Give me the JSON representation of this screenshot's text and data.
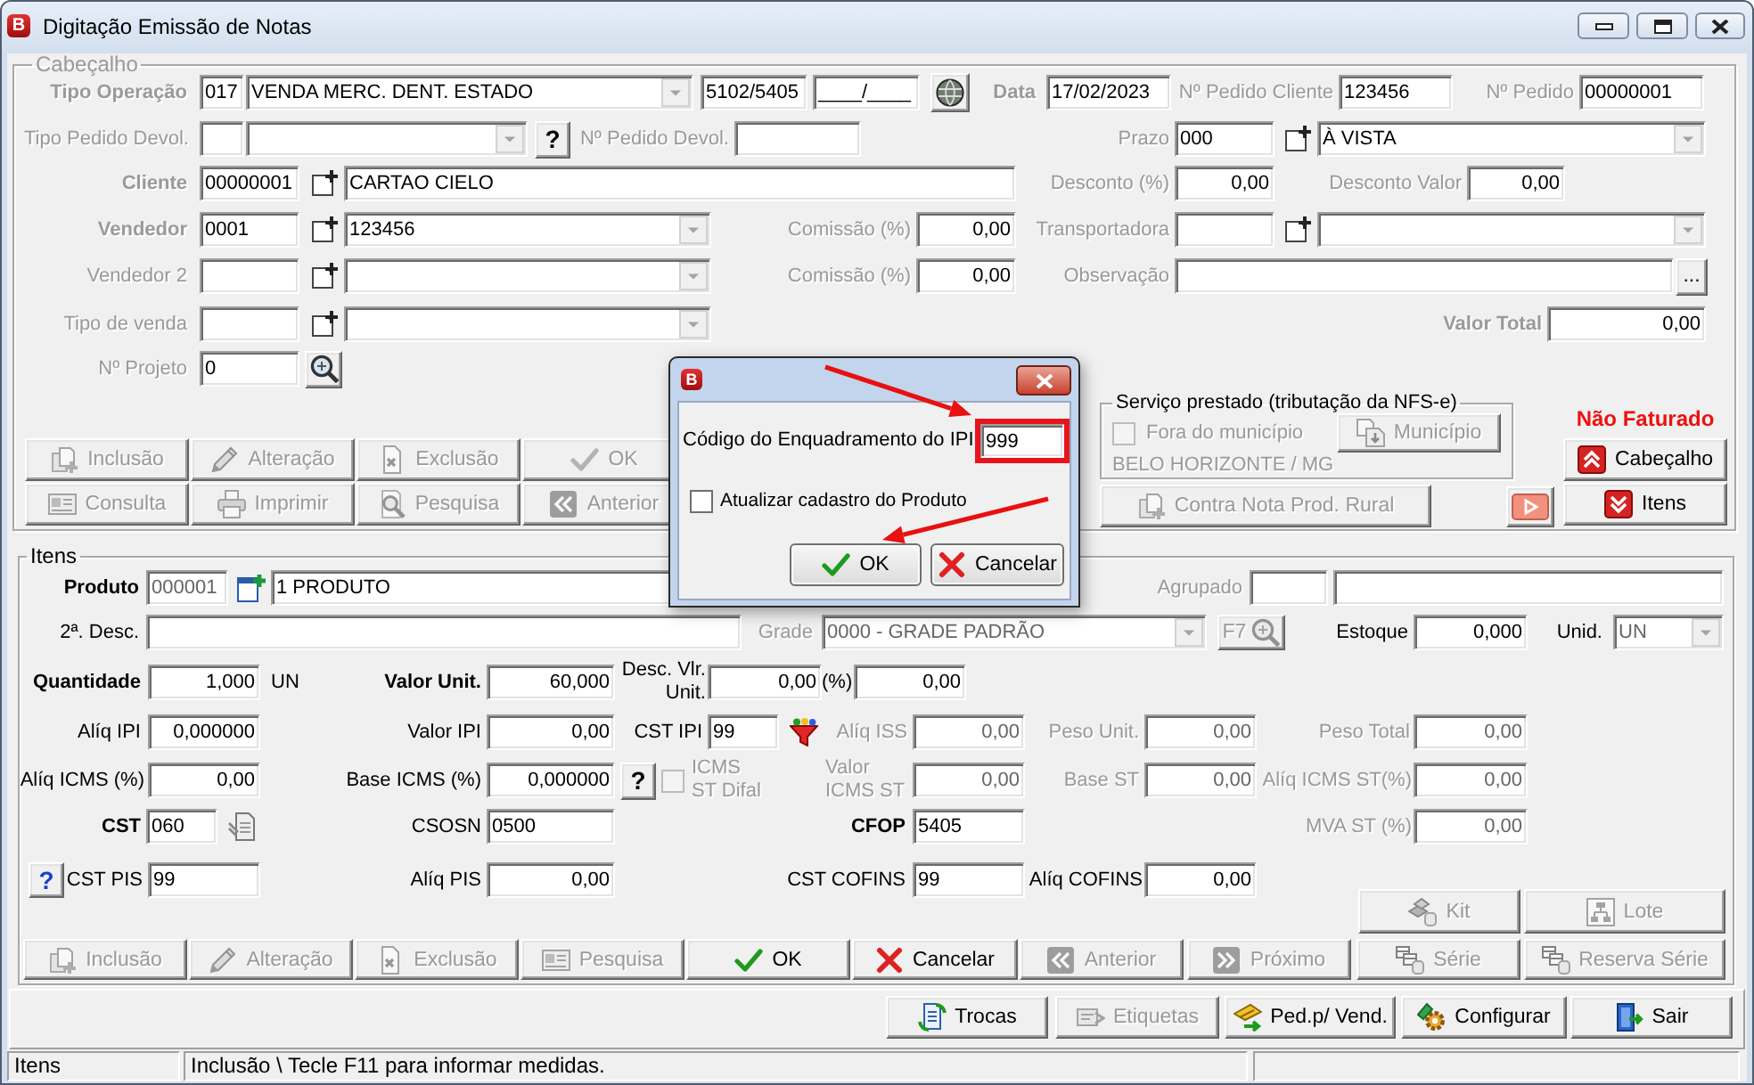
{
  "window": {
    "logo": "B",
    "title": "Digitação Emissão de Notas"
  },
  "header": {
    "legend": "Cabeçalho",
    "disabled": true,
    "tipo_operacao": {
      "label": "Tipo Operação",
      "code": "017",
      "description": "VENDA MERC. DENT. ESTADO",
      "cfop": "5102/5405",
      "cfop_2": "____/____"
    },
    "data": {
      "label": "Data",
      "value": "17/02/2023"
    },
    "pedido_cliente": {
      "label": "Nº Pedido Cliente",
      "value": "123456"
    },
    "pedido": {
      "label": "Nº Pedido",
      "value": "00000001"
    },
    "tipo_pedido_devol": {
      "label": "Tipo Pedido Devol.",
      "help": "?"
    },
    "pedido_devol": {
      "label": "Nº Pedido Devol."
    },
    "prazo": {
      "label": "Prazo",
      "code": "000",
      "description": "À VISTA"
    },
    "cliente": {
      "label": "Cliente",
      "code": "00000001",
      "name": "CARTAO CIELO"
    },
    "desconto_pct": {
      "label": "Desconto (%)",
      "value": "0,00"
    },
    "desconto_valor": {
      "label": "Desconto Valor",
      "value": "0,00"
    },
    "vendedor": {
      "label": "Vendedor",
      "code": "0001",
      "name": "123456"
    },
    "comissao": {
      "label": "Comissão (%)",
      "value": "0,00"
    },
    "transportadora": {
      "label": "Transportadora"
    },
    "vendedor_2": {
      "label": "Vendedor 2"
    },
    "comissao_2": {
      "label": "Comissão (%)",
      "value": "0,00"
    },
    "observacao": {
      "label": "Observação",
      "button": "..."
    },
    "tipo_venda": {
      "label": "Tipo de venda"
    },
    "valor_total": {
      "label": "Valor Total",
      "value": "0,00"
    },
    "projeto": {
      "label": "Nº Projeto",
      "value": "0"
    },
    "buttons": [
      {
        "label": "Inclusão",
        "disabled": true
      },
      {
        "label": "Alteração",
        "disabled": true
      },
      {
        "label": "Exclusão",
        "disabled": true
      },
      {
        "label": "OK",
        "disabled": true
      },
      {
        "label": "Consulta",
        "disabled": true
      },
      {
        "label": "Imprimir",
        "disabled": true
      },
      {
        "label": "Pesquisa",
        "disabled": true
      },
      {
        "label": "Anterior",
        "disabled": true
      }
    ],
    "servico": {
      "legend": "Serviço prestado (tributação da NFS-e)",
      "disabled": true,
      "fora_municipio": {
        "label": "Fora do município",
        "checked": false
      },
      "municipio_button": "Município",
      "location": "BELO HORIZONTE / MG"
    },
    "contra_nota_button": {
      "label": "Contra Nota Prod. Rural",
      "disabled": true
    },
    "status": "Não Faturado",
    "section_buttons": [
      {
        "label": "Cabeçalho"
      },
      {
        "label": "Itens"
      }
    ]
  },
  "items": {
    "legend": "Itens",
    "produto": {
      "label": "Produto",
      "disabled": false,
      "code": "000001",
      "code_disabled": true,
      "name": "1 PRODUTO"
    },
    "agrupado": {
      "label": "Agrupado",
      "disabled": true
    },
    "desc_2": {
      "label": "2ª. Desc.",
      "disabled": false
    },
    "grade": {
      "label": "Grade",
      "value": "0000 - GRADE PADRÃO",
      "disabled": true
    },
    "f7_button": {
      "label": "F7",
      "disabled": true
    },
    "estoque": {
      "label": "Estoque",
      "value": "0,000",
      "disabled": false
    },
    "unid": {
      "label": "Unid.",
      "value": "UN",
      "disabled": false,
      "field_disabled": true
    },
    "quantidade": {
      "label": "Quantidade",
      "value": "1,000",
      "unit": "UN",
      "disabled": false
    },
    "valor_unit": {
      "label": "Valor Unit.",
      "value": "60,000",
      "disabled": false
    },
    "desc_vlr_unit": {
      "label": "Desc. Vlr. Unit.",
      "value": "0,00",
      "pct_label": "(%)",
      "pct_value": "0,00",
      "disabled": false
    },
    "aliq_ipi": {
      "label": "Alíq IPI",
      "value": "0,000000",
      "disabled": false
    },
    "valor_ipi": {
      "label": "Valor IPI",
      "value": "0,00",
      "disabled": false
    },
    "cst_ipi": {
      "label": "CST IPI",
      "value": "99",
      "disabled": false
    },
    "aliq_iss": {
      "label": "Alíq ISS",
      "value": "0,00",
      "disabled": true
    },
    "peso_unit": {
      "label": "Peso Unit.",
      "value": "0,00",
      "disabled": true
    },
    "peso_total": {
      "label": "Peso Total",
      "value": "0,00",
      "disabled": true
    },
    "aliq_icms": {
      "label": "Alíq ICMS (%)",
      "value": "0,00",
      "disabled": false
    },
    "base_icms": {
      "label": "Base ICMS (%)",
      "value": "0,000000",
      "help": "?",
      "disabled": false
    },
    "icms_st_difal": {
      "label": "ICMS ST Difal",
      "checked": false,
      "disabled": true
    },
    "valor_icms_st": {
      "label": "Valor ICMS ST",
      "value": "0,00",
      "disabled": true
    },
    "base_st": {
      "label": "Base ST",
      "value": "0,00",
      "disabled": true
    },
    "aliq_icms_st": {
      "label": "Alíq ICMS ST(%)",
      "value": "0,00",
      "disabled": true
    },
    "cst": {
      "label": "CST",
      "value": "060",
      "disabled": false
    },
    "csosn": {
      "label": "CSOSN",
      "value": "0500",
      "disabled": false
    },
    "cfop": {
      "label": "CFOP",
      "value": "5405",
      "disabled": false
    },
    "mva_st": {
      "label": "MVA ST (%)",
      "value": "0,00",
      "disabled": true
    },
    "cst_pis": {
      "label": "CST PIS",
      "value": "99",
      "help": "?",
      "disabled": false
    },
    "aliq_pis": {
      "label": "Alíq PIS",
      "value": "0,00",
      "disabled": false
    },
    "cst_cofins": {
      "label": "CST COFINS",
      "value": "99",
      "disabled": false
    },
    "aliq_cofins": {
      "label": "Alíq COFINS",
      "value": "0,00",
      "disabled": false
    },
    "side_buttons": [
      {
        "label": "Kit",
        "disabled": true
      },
      {
        "label": "Lote",
        "disabled": true
      }
    ],
    "buttons": [
      {
        "label": "Inclusão",
        "disabled": true
      },
      {
        "label": "Alteração",
        "disabled": true
      },
      {
        "label": "Exclusão",
        "disabled": true
      },
      {
        "label": "Pesquisa",
        "disabled": true
      },
      {
        "label": "OK",
        "disabled": false
      },
      {
        "label": "Cancelar",
        "disabled": false
      },
      {
        "label": "Anterior",
        "disabled": true
      },
      {
        "label": "Próximo",
        "disabled": true
      },
      {
        "label": "Série",
        "disabled": true
      },
      {
        "label": "Reserva Série",
        "disabled": true
      }
    ]
  },
  "toolbar": [
    {
      "label": "Trocas",
      "disabled": false
    },
    {
      "label": "Etiquetas",
      "disabled": true
    },
    {
      "label": "Ped.p/ Vend.",
      "disabled": false
    },
    {
      "label": "Configurar",
      "disabled": false
    },
    {
      "label": "Sair",
      "disabled": false
    }
  ],
  "status_bar": [
    "Itens",
    "Inclusão \\ Tecle F11 para informar medidas."
  ],
  "dialog": {
    "logo": "B",
    "field_label": "Código do Enquadramento do IPI",
    "field_value": "999",
    "checkbox": {
      "label": "Atualizar cadastro do Produto",
      "checked": false
    },
    "buttons": [
      {
        "label": "OK"
      },
      {
        "label": "Cancelar"
      }
    ]
  }
}
